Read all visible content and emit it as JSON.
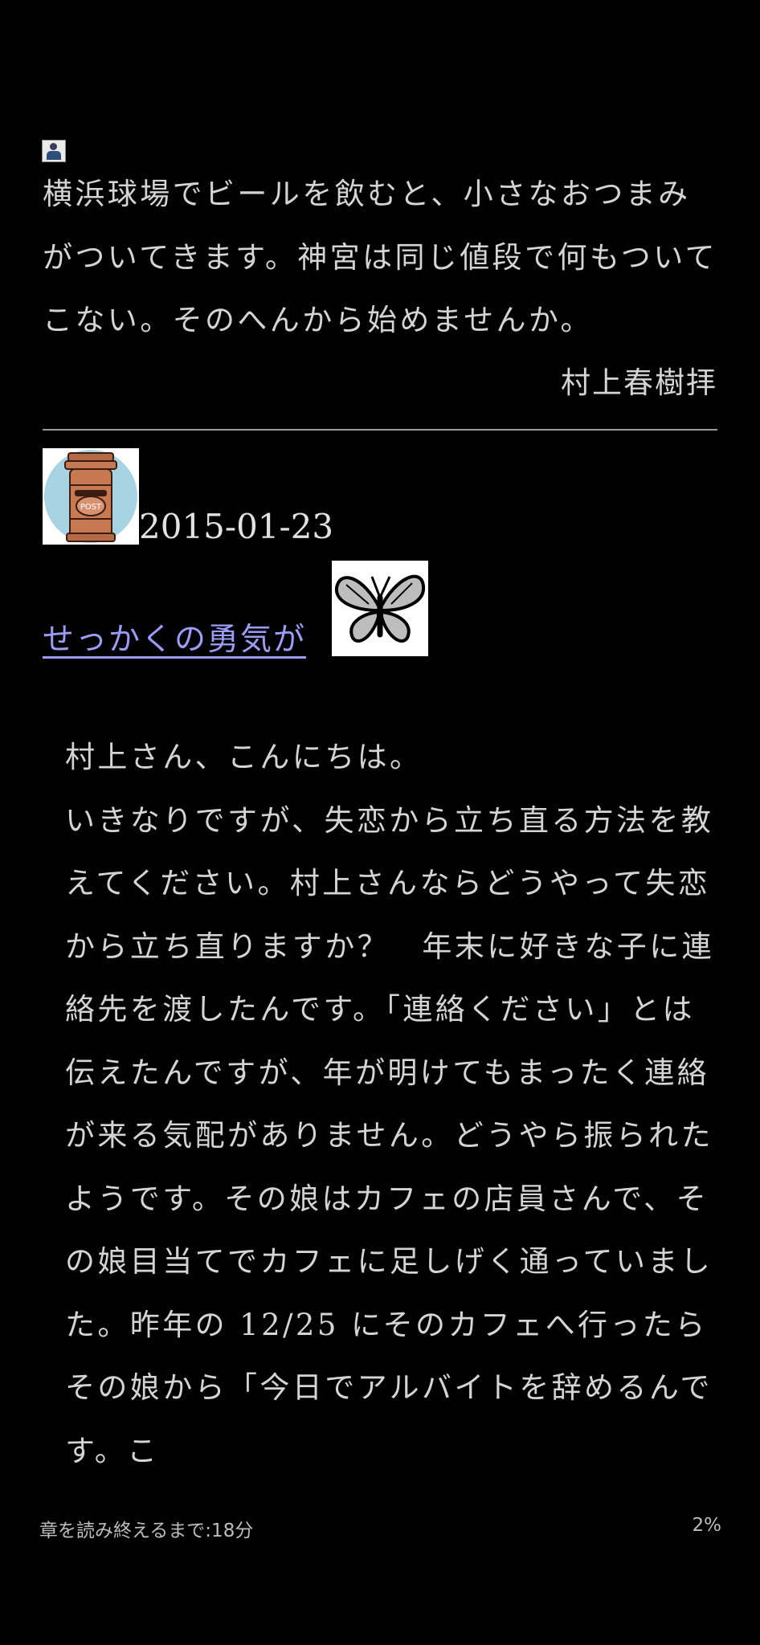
{
  "previous_answer": {
    "paragraph": "横浜球場でビールを飲むと、小さなおつまみがついてきます。神宮は同じ値段で何もついてこない。そのへんから始めませんか。",
    "signature": "村上春樹拝"
  },
  "entry": {
    "icon": "post-box-icon",
    "date": "2015-01-23",
    "title": "せっかくの勇気が",
    "title_icon": "butterfly-icon",
    "greeting": "村上さん、こんにちは。",
    "body": "いきなりですが、失恋から立ち直る方法を教えてください。村上さんならどうやって失恋から立ち直りますか？　年末に好きな子に連絡先を渡したんです。「連絡ください」とは伝えたんですが、年が明けてもまったく連絡が来る気配がありません。どうやら振られたようです。その娘はカフェの店員さんで、その娘目当てでカフェに足しげく通っていました。昨年の 12/25 にそのカフェへ行ったらその娘から「今日でアルバイトを辞めるんです。こ"
  },
  "footer": {
    "time_remaining": "章を読み終えるまで:18分",
    "progress": "2%"
  },
  "colors": {
    "background": "#000000",
    "text": "#d4d4d4",
    "link": "#9a9cf5",
    "divider": "#9a9a9a"
  }
}
